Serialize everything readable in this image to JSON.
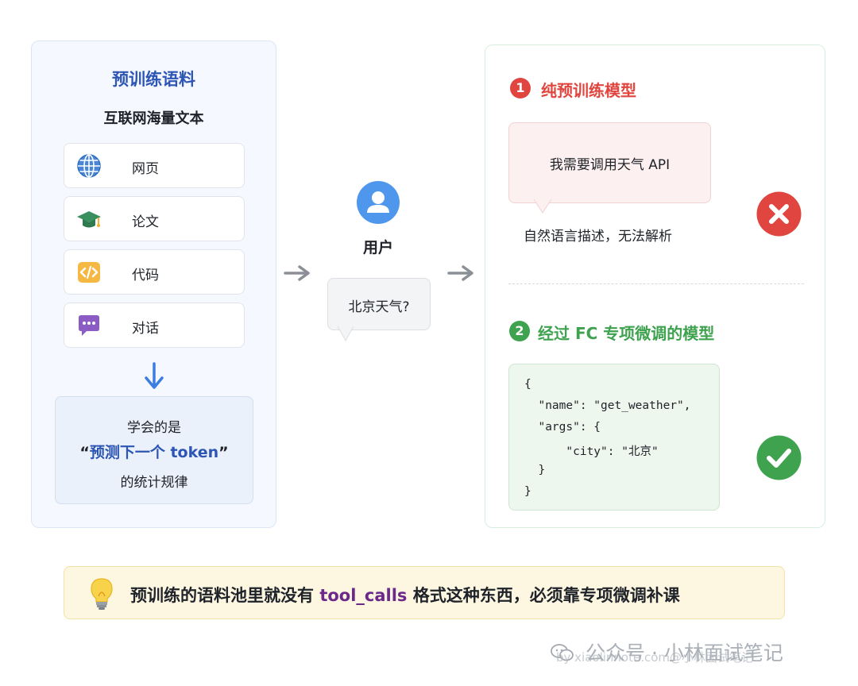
{
  "corpus": {
    "title": "预训练语料",
    "subtitle": "互联网海量文本",
    "sources": [
      {
        "label": "网页",
        "icon": "globe-icon"
      },
      {
        "label": "论文",
        "icon": "graduation-cap-icon"
      },
      {
        "label": "代码",
        "icon": "code-icon"
      },
      {
        "label": "对话",
        "icon": "chat-icon"
      }
    ],
    "summary": {
      "line1": "学会的是",
      "quote_open": "“",
      "highlight": "预测下一个 token",
      "quote_close": "”",
      "line3": "的统计规律"
    }
  },
  "user": {
    "label": "用户",
    "message": "北京天气?"
  },
  "raw_model": {
    "number": "1",
    "title": "纯预训练模型",
    "bubble": "我需要调用天气 API",
    "note": "自然语言描述，无法解析",
    "status_icon": "cross-icon"
  },
  "fc_model": {
    "number": "2",
    "title": "经过 FC 专项微调的模型",
    "code_lines": [
      "{",
      "  \"name\": \"get_weather\",",
      "  \"args\": {",
      "      \"city\": \"北京\"",
      "  }",
      "}"
    ],
    "status_icon": "check-icon"
  },
  "tip": {
    "before": "预训练的语料池里就没有 ",
    "code": "tool_calls",
    "after": " 格式这种东西，必须靠专项微调补课"
  },
  "watermark": {
    "main": "公众号 · 小林面试笔记",
    "sub": "by xiaolinnote.com@小林面试笔记"
  },
  "colors": {
    "blue_title": "#2c55b4",
    "red": "#e0463f",
    "green": "#3fa24f",
    "purple_code": "#6b2a8a"
  }
}
